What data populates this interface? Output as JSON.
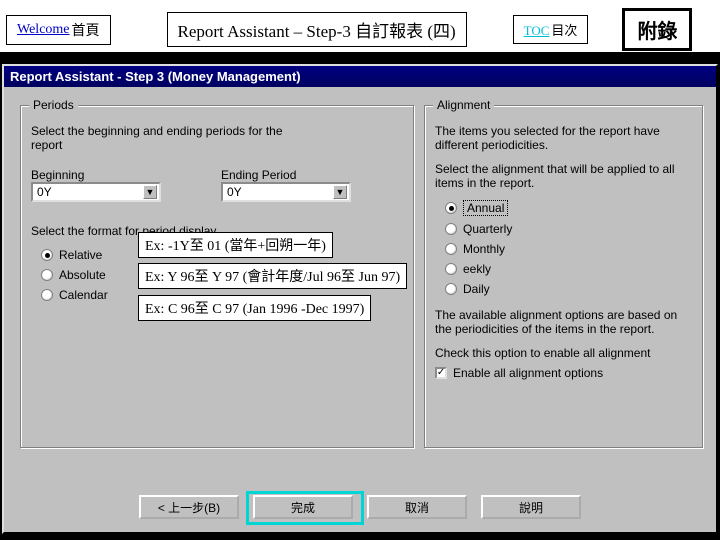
{
  "nav": {
    "welcome_link": "Welcome",
    "welcome_suffix": "首頁",
    "title": "Report Assistant – Step-3 自訂報表 (四)",
    "toc_link": "TOC",
    "toc_suffix": "目次",
    "appendix": "附錄"
  },
  "window": {
    "title": "Report Assistant - Step 3  (Money Management)"
  },
  "periods": {
    "legend": "Periods",
    "desc": "Select the beginning and ending periods for the report",
    "beginning_label": "Beginning",
    "ending_label": "Ending Period",
    "beginning_value": "0Y",
    "ending_value": "0Y",
    "format_label": "Select the format for period display",
    "relative": "Relative",
    "absolute": "Absolute",
    "calendar": "Calendar"
  },
  "alignment": {
    "legend": "Alignment",
    "desc1": "The items you selected for the report have different periodicities.",
    "desc2": "Select the alignment that will be applied to all items in the report.",
    "annual": "Annual",
    "quarterly": "Quarterly",
    "monthly": "Monthly",
    "weekly_suffix": "eekly",
    "daily": "Daily",
    "note1": "The available alignment options are based on the periodicities of the items in the report.",
    "note2": "Check this option to enable all alignment",
    "enable_all": "Enable all alignment options"
  },
  "buttons": {
    "back": "< 上一步(B)",
    "finish": "完成",
    "cancel": "取消",
    "help": "說明"
  },
  "annotations": {
    "relative_ex": "Ex: -1Y至 01 (當年+回朔一年)",
    "absolute_ex": "Ex: Y 96至 Y 97 (會計年度/Jul 96至 Jun 97)",
    "calendar_ex": "Ex: C 96至 C 97 (Jan 1996 -Dec 1997)"
  }
}
